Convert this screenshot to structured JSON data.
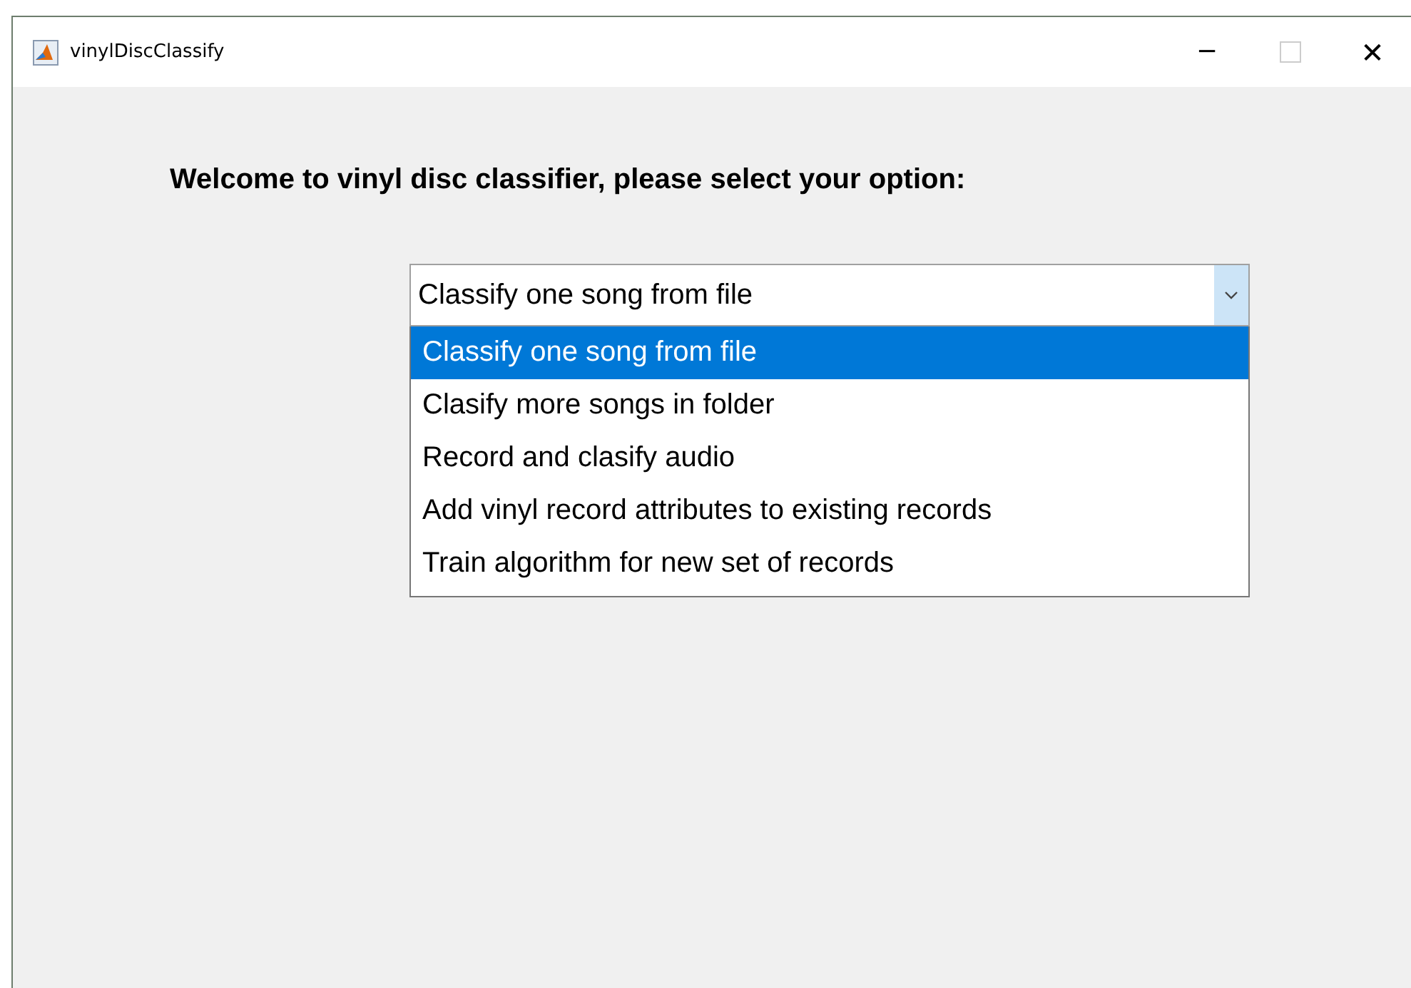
{
  "window": {
    "title": "vinylDiscClassify",
    "minimize": "─",
    "maximize_disabled": true,
    "close": "✕"
  },
  "heading": "Welcome to vinyl disc classifier, please select your option:",
  "dropdown": {
    "value": "Classify one song from file",
    "expanded": true,
    "options": [
      {
        "label": "Classify one song from file",
        "selected": true
      },
      {
        "label": "Clasify more songs in folder",
        "selected": false
      },
      {
        "label": "Record and clasify audio",
        "selected": false
      },
      {
        "label": "Add vinyl record attributes to existing records",
        "selected": false
      },
      {
        "label": "Train algorithm for new set of records",
        "selected": false
      }
    ]
  }
}
